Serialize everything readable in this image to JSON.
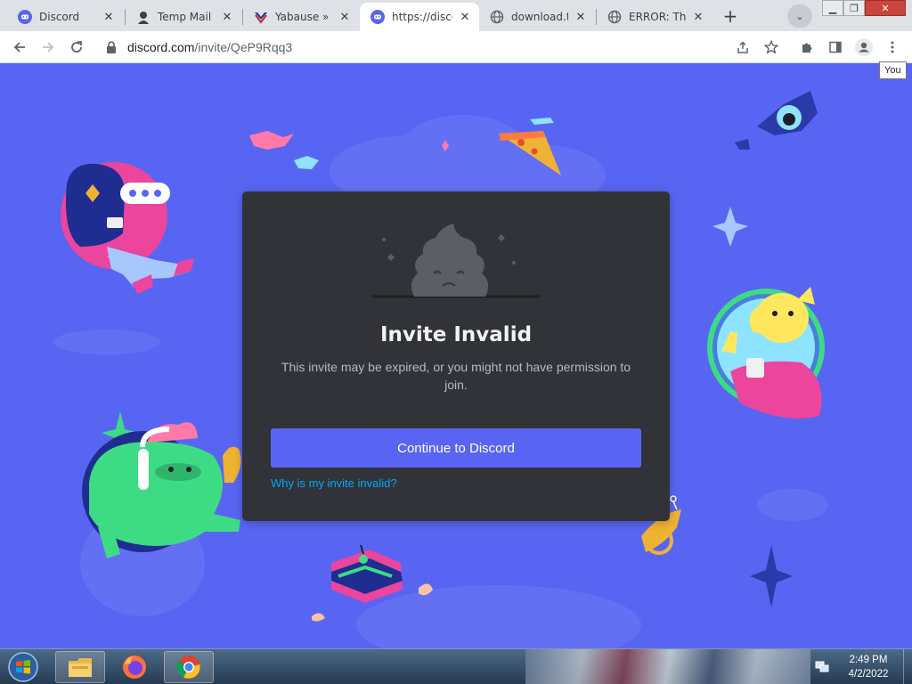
{
  "browser": {
    "tabs": [
      {
        "title": "Discord",
        "icon": "discord-icon"
      },
      {
        "title": "Temp Mail -",
        "icon": "temp-mail-icon"
      },
      {
        "title": "Yabause » Do",
        "icon": "yabause-icon"
      },
      {
        "title": "https://disco",
        "icon": "discord-icon",
        "active": true
      },
      {
        "title": "download.tu",
        "icon": "globe-icon"
      },
      {
        "title": "ERROR: The",
        "icon": "globe-icon"
      }
    ],
    "url_domain": "discord.com",
    "url_path": "/invite/QeP9Rqq3",
    "profile_tooltip": "You"
  },
  "invite": {
    "title": "Invite Invalid",
    "description": "This invite may be expired, or you might not have permission to join.",
    "button_label": "Continue to Discord",
    "link_label": "Why is my invite invalid?"
  },
  "colors": {
    "blurple": "#5865f2",
    "card": "#313338",
    "link": "#00a8fc"
  },
  "taskbar": {
    "apps": [
      "windows-explorer-icon",
      "firefox-icon",
      "chrome-icon"
    ],
    "time": "2:49 PM",
    "date": "4/2/2022"
  }
}
